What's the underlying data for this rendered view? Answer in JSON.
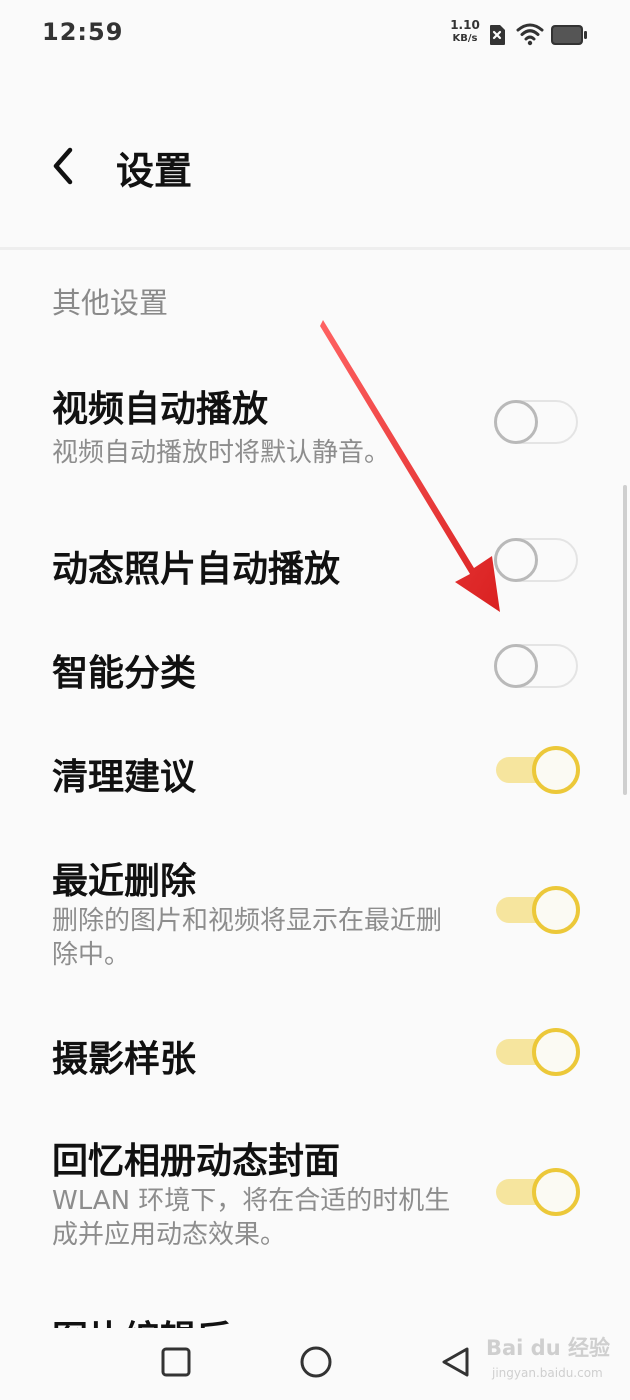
{
  "status_bar": {
    "time": "12:59",
    "net_speed_value": "1.10",
    "net_speed_unit": "KB/s",
    "icons": [
      "sim-off-icon",
      "wifi-icon",
      "battery-icon"
    ]
  },
  "header": {
    "title": "设置",
    "back_icon": "chevron-left-icon"
  },
  "section": {
    "title": "其他设置"
  },
  "settings": [
    {
      "title": "视频自动播放",
      "description": "视频自动播放时将默认静音。",
      "enabled": false
    },
    {
      "title": "动态照片自动播放",
      "description": "",
      "enabled": false
    },
    {
      "title": "智能分类",
      "description": "",
      "enabled": false
    },
    {
      "title": "清理建议",
      "description": "",
      "enabled": true
    },
    {
      "title": "最近删除",
      "description": "删除的图片和视频将显示在最近删除中。",
      "enabled": true
    },
    {
      "title": "摄影样张",
      "description": "",
      "enabled": true
    },
    {
      "title": "回忆相册动态封面",
      "description": "WLAN 环境下，将在合适的时机生成并应用动态效果。",
      "enabled": true
    }
  ],
  "partial_row": {
    "title": "图片编辑后"
  },
  "nav_bar": {
    "buttons": [
      "recents-square-icon",
      "home-circle-icon",
      "back-triangle-icon"
    ]
  },
  "watermark": {
    "logo": "Bai du 经验",
    "sub": "jingyan.baidu.com"
  },
  "colors": {
    "background": "#fafafa",
    "toggle_on_track": "#f6e59e",
    "toggle_on_knob_border": "#ecc839",
    "toggle_off_border": "#b9b9b9",
    "annotation_arrow": "#e02020"
  }
}
